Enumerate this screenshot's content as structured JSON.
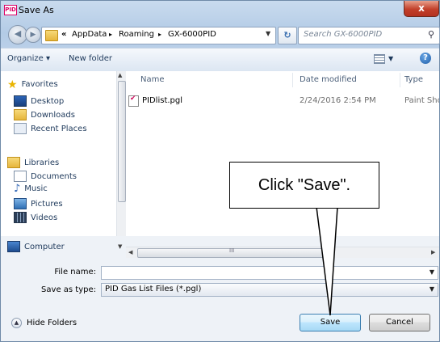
{
  "window": {
    "app_icon_text": "PID",
    "title": "Save As",
    "close_label": "x"
  },
  "nav": {
    "back_icon": "back-arrow-icon",
    "forward_icon": "forward-arrow-icon",
    "breadcrumb": [
      "«",
      "AppData",
      "Roaming",
      "GX-6000PID"
    ],
    "breadcrumb_sep": "▸",
    "search_placeholder": "Search GX-6000PID"
  },
  "toolbar": {
    "organize_label": "Organize ▾",
    "new_folder_label": "New folder",
    "help_label": "?"
  },
  "sidebar": {
    "favorites_label": "Favorites",
    "favorites_items": [
      "Desktop",
      "Downloads",
      "Recent Places"
    ],
    "libraries_label": "Libraries",
    "libraries_items": [
      "Documents",
      "Music",
      "Pictures",
      "Videos"
    ],
    "computer_label": "Computer"
  },
  "files": {
    "columns": {
      "name": "Name",
      "date": "Date modified",
      "type": "Type"
    },
    "rows": [
      {
        "name": "PIDlist.pgl",
        "date": "2/24/2016 2:54 PM",
        "type": "Paint Sho"
      }
    ]
  },
  "form": {
    "file_name_label": "File name:",
    "file_name_value": "",
    "save_type_label": "Save as type:",
    "save_type_value": "PID Gas List Files (*.pgl)"
  },
  "buttons": {
    "hide_folders": "Hide Folders",
    "save": "Save",
    "cancel": "Cancel"
  },
  "callout": {
    "text": "Click \"Save\"."
  },
  "colors": {
    "accent": "#1e395b",
    "close": "#c2402a",
    "primary_button": "#bee6fd"
  }
}
